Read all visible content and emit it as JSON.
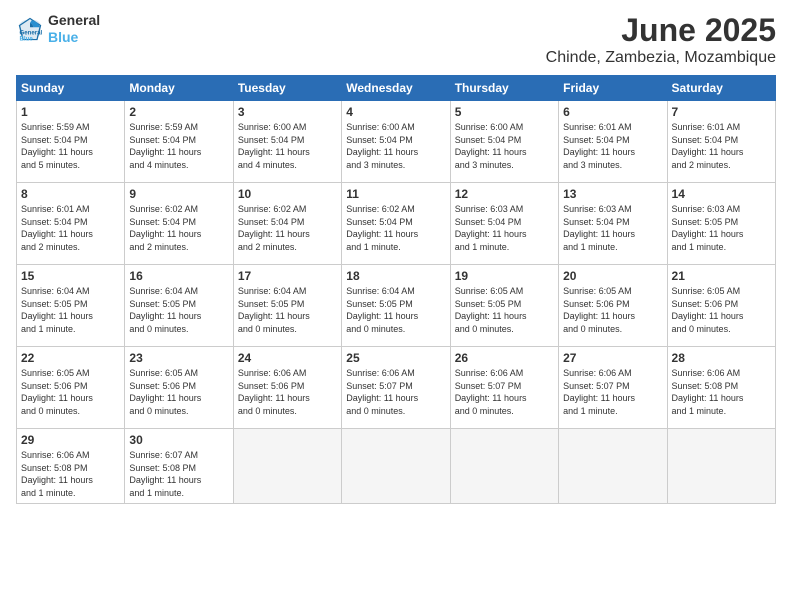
{
  "logo": {
    "line1": "General",
    "line2": "Blue"
  },
  "title": "June 2025",
  "subtitle": "Chinde, Zambezia, Mozambique",
  "weekdays": [
    "Sunday",
    "Monday",
    "Tuesday",
    "Wednesday",
    "Thursday",
    "Friday",
    "Saturday"
  ],
  "weeks": [
    [
      {
        "day": "1",
        "info": "Sunrise: 5:59 AM\nSunset: 5:04 PM\nDaylight: 11 hours\nand 5 minutes."
      },
      {
        "day": "2",
        "info": "Sunrise: 5:59 AM\nSunset: 5:04 PM\nDaylight: 11 hours\nand 4 minutes."
      },
      {
        "day": "3",
        "info": "Sunrise: 6:00 AM\nSunset: 5:04 PM\nDaylight: 11 hours\nand 4 minutes."
      },
      {
        "day": "4",
        "info": "Sunrise: 6:00 AM\nSunset: 5:04 PM\nDaylight: 11 hours\nand 3 minutes."
      },
      {
        "day": "5",
        "info": "Sunrise: 6:00 AM\nSunset: 5:04 PM\nDaylight: 11 hours\nand 3 minutes."
      },
      {
        "day": "6",
        "info": "Sunrise: 6:01 AM\nSunset: 5:04 PM\nDaylight: 11 hours\nand 3 minutes."
      },
      {
        "day": "7",
        "info": "Sunrise: 6:01 AM\nSunset: 5:04 PM\nDaylight: 11 hours\nand 2 minutes."
      }
    ],
    [
      {
        "day": "8",
        "info": "Sunrise: 6:01 AM\nSunset: 5:04 PM\nDaylight: 11 hours\nand 2 minutes."
      },
      {
        "day": "9",
        "info": "Sunrise: 6:02 AM\nSunset: 5:04 PM\nDaylight: 11 hours\nand 2 minutes."
      },
      {
        "day": "10",
        "info": "Sunrise: 6:02 AM\nSunset: 5:04 PM\nDaylight: 11 hours\nand 2 minutes."
      },
      {
        "day": "11",
        "info": "Sunrise: 6:02 AM\nSunset: 5:04 PM\nDaylight: 11 hours\nand 1 minute."
      },
      {
        "day": "12",
        "info": "Sunrise: 6:03 AM\nSunset: 5:04 PM\nDaylight: 11 hours\nand 1 minute."
      },
      {
        "day": "13",
        "info": "Sunrise: 6:03 AM\nSunset: 5:04 PM\nDaylight: 11 hours\nand 1 minute."
      },
      {
        "day": "14",
        "info": "Sunrise: 6:03 AM\nSunset: 5:05 PM\nDaylight: 11 hours\nand 1 minute."
      }
    ],
    [
      {
        "day": "15",
        "info": "Sunrise: 6:04 AM\nSunset: 5:05 PM\nDaylight: 11 hours\nand 1 minute."
      },
      {
        "day": "16",
        "info": "Sunrise: 6:04 AM\nSunset: 5:05 PM\nDaylight: 11 hours\nand 0 minutes."
      },
      {
        "day": "17",
        "info": "Sunrise: 6:04 AM\nSunset: 5:05 PM\nDaylight: 11 hours\nand 0 minutes."
      },
      {
        "day": "18",
        "info": "Sunrise: 6:04 AM\nSunset: 5:05 PM\nDaylight: 11 hours\nand 0 minutes."
      },
      {
        "day": "19",
        "info": "Sunrise: 6:05 AM\nSunset: 5:05 PM\nDaylight: 11 hours\nand 0 minutes."
      },
      {
        "day": "20",
        "info": "Sunrise: 6:05 AM\nSunset: 5:06 PM\nDaylight: 11 hours\nand 0 minutes."
      },
      {
        "day": "21",
        "info": "Sunrise: 6:05 AM\nSunset: 5:06 PM\nDaylight: 11 hours\nand 0 minutes."
      }
    ],
    [
      {
        "day": "22",
        "info": "Sunrise: 6:05 AM\nSunset: 5:06 PM\nDaylight: 11 hours\nand 0 minutes."
      },
      {
        "day": "23",
        "info": "Sunrise: 6:05 AM\nSunset: 5:06 PM\nDaylight: 11 hours\nand 0 minutes."
      },
      {
        "day": "24",
        "info": "Sunrise: 6:06 AM\nSunset: 5:06 PM\nDaylight: 11 hours\nand 0 minutes."
      },
      {
        "day": "25",
        "info": "Sunrise: 6:06 AM\nSunset: 5:07 PM\nDaylight: 11 hours\nand 0 minutes."
      },
      {
        "day": "26",
        "info": "Sunrise: 6:06 AM\nSunset: 5:07 PM\nDaylight: 11 hours\nand 0 minutes."
      },
      {
        "day": "27",
        "info": "Sunrise: 6:06 AM\nSunset: 5:07 PM\nDaylight: 11 hours\nand 1 minute."
      },
      {
        "day": "28",
        "info": "Sunrise: 6:06 AM\nSunset: 5:08 PM\nDaylight: 11 hours\nand 1 minute."
      }
    ],
    [
      {
        "day": "29",
        "info": "Sunrise: 6:06 AM\nSunset: 5:08 PM\nDaylight: 11 hours\nand 1 minute."
      },
      {
        "day": "30",
        "info": "Sunrise: 6:07 AM\nSunset: 5:08 PM\nDaylight: 11 hours\nand 1 minute."
      },
      {
        "day": "",
        "info": ""
      },
      {
        "day": "",
        "info": ""
      },
      {
        "day": "",
        "info": ""
      },
      {
        "day": "",
        "info": ""
      },
      {
        "day": "",
        "info": ""
      }
    ]
  ]
}
